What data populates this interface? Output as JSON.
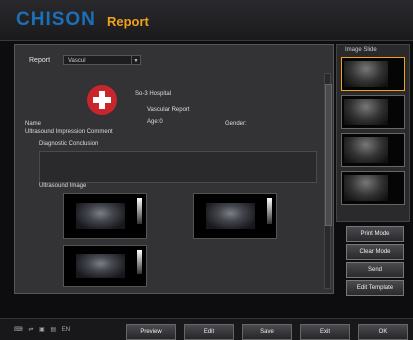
{
  "header": {
    "logo": "CHISON",
    "title": "Report"
  },
  "report": {
    "label": "Report",
    "selected": "Vascul",
    "hospital": "So-3 Hospital",
    "report_title": "Vascular Report",
    "name_label": "Name",
    "age_label": "Age:0",
    "gender_label": "Gender:",
    "comments_label": "Ultrasound Impression Comment",
    "diagnostic_label": "Diagnostic Conclusion",
    "images_label": "Ultrasound Image"
  },
  "thumbs": {
    "header": "Image Slide"
  },
  "side_buttons": [
    "Print Mode",
    "Clear Mode",
    "Send",
    "Edit Template"
  ],
  "bottom_buttons": [
    "Preview",
    "Edit",
    "Save",
    "Exit",
    "OK"
  ],
  "status": {
    "icons": [
      "keyboard-icon",
      "usb-icon",
      "printer-icon",
      "network-icon"
    ],
    "lang": "EN"
  },
  "colors": {
    "accent": "#f0a21c",
    "brand": "#1c6fb8",
    "panel": "#333336"
  }
}
